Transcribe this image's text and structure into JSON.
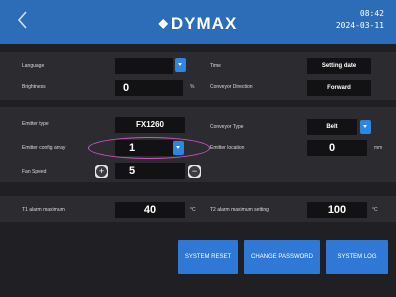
{
  "header": {
    "logo": "DYMAX",
    "time": "08:42",
    "date": "2024-03-11"
  },
  "settings": {
    "language_label": "Language",
    "language_value": "",
    "brightness_label": "Brightness",
    "brightness_value": "0",
    "brightness_unit": "%",
    "time_label": "Time",
    "time_value": "Setting date",
    "conveyor_direction_label": "Conveyor Direction",
    "conveyor_direction_value": "Forward",
    "emitter_type_label": "Emitter type",
    "emitter_type_value": "FX1260",
    "emitter_config_label": "Emitter config array",
    "emitter_config_value": "1",
    "fan_speed_label": "Fan Speed",
    "fan_speed_value": "5",
    "conveyor_type_label": "Conveyor Type",
    "conveyor_type_value": "Belt",
    "emitter_location_label": "Emitter location",
    "emitter_location_value": "0",
    "emitter_location_unit": "mm",
    "t1_label": "T1 alarm maximum",
    "t1_value": "40",
    "t1_unit": "°C",
    "t2_label": "T2 alarm maximum setting",
    "t2_value": "100",
    "t2_unit": "°C"
  },
  "buttons": {
    "system_reset": "SYSTEM RESET",
    "change_password": "CHANGE PASSWORD",
    "system_log": "SYSTEM LOG"
  },
  "icons": [
    "back-chevron-icon",
    "dropdown-arrow-icon",
    "plus-icon",
    "minus-icon"
  ],
  "colors": {
    "header": "#2d6db8",
    "accent": "#2f86e0",
    "highlight": "#d455c8"
  }
}
